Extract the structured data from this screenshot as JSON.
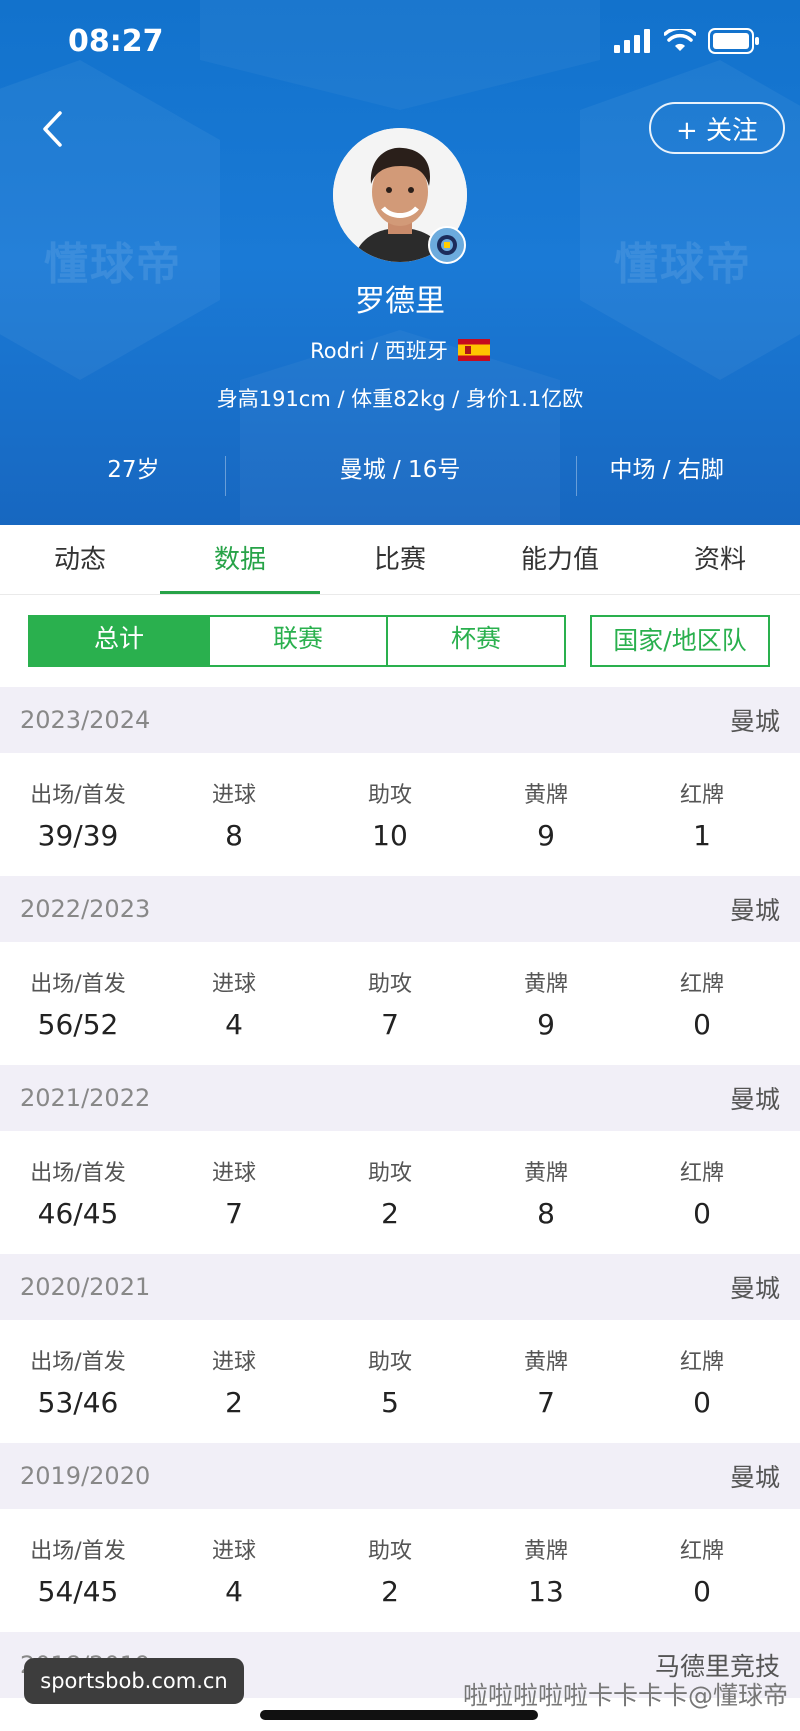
{
  "status_bar": {
    "time": "08:27"
  },
  "header": {
    "follow_label": "+ 关注",
    "watermark": "懂球帝"
  },
  "player": {
    "name": "罗德里",
    "origin": "Rodri / 西班牙",
    "measurements": "身高191cm / 体重82kg / 身价1.1亿欧",
    "age": "27岁",
    "club_number": "曼城 / 16号",
    "position_foot": "中场 / 右脚"
  },
  "tabs": [
    "动态",
    "数据",
    "比赛",
    "能力值",
    "资料"
  ],
  "subtabs": [
    "总计",
    "联赛",
    "杯赛",
    "国家/地区队"
  ],
  "stat_labels": [
    "出场/首发",
    "进球",
    "助攻",
    "黄牌",
    "红牌"
  ],
  "seasons": [
    {
      "year": "2023/2024",
      "club": "曼城",
      "values": [
        "39/39",
        "8",
        "10",
        "9",
        "1"
      ]
    },
    {
      "year": "2022/2023",
      "club": "曼城",
      "values": [
        "56/52",
        "4",
        "7",
        "9",
        "0"
      ]
    },
    {
      "year": "2021/2022",
      "club": "曼城",
      "values": [
        "46/45",
        "7",
        "2",
        "8",
        "0"
      ]
    },
    {
      "year": "2020/2021",
      "club": "曼城",
      "values": [
        "53/46",
        "2",
        "5",
        "7",
        "0"
      ]
    },
    {
      "year": "2019/2020",
      "club": "曼城",
      "values": [
        "54/45",
        "4",
        "2",
        "13",
        "0"
      ]
    },
    {
      "year": "2018/2019",
      "club": "马德里竞技"
    }
  ],
  "footer": {
    "source": "sportsbob.com.cn",
    "watermark_text": "啦啦啦啦啦卡卡卡卡@懂球帝"
  },
  "colors": {
    "header_blue": "#1272cc",
    "accent_green": "#2ab04e"
  }
}
